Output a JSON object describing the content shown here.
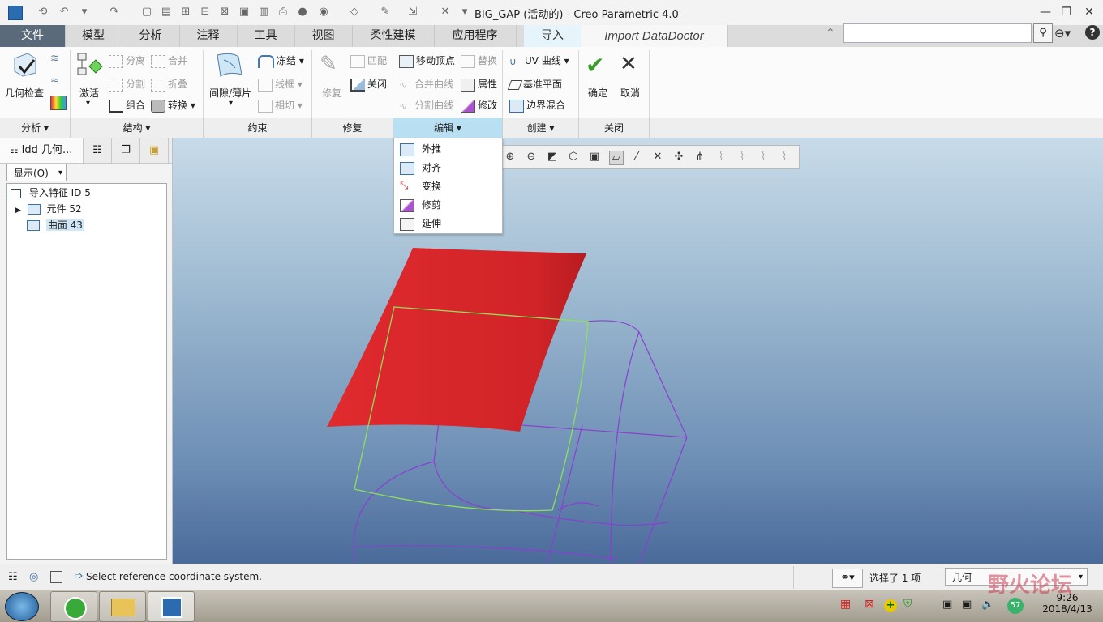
{
  "window": {
    "title": "BIG_GAP (活动的) - Creo Parametric 4.0",
    "minimize": "—",
    "maximize": "❐",
    "close": "✕"
  },
  "tabs": [
    {
      "label": "文件"
    },
    {
      "label": "模型"
    },
    {
      "label": "分析"
    },
    {
      "label": "注释"
    },
    {
      "label": "工具"
    },
    {
      "label": "视图"
    },
    {
      "label": "柔性建模"
    },
    {
      "label": "应用程序"
    },
    {
      "label": "导入"
    },
    {
      "label": "Import DataDoctor"
    }
  ],
  "search": {
    "value": ""
  },
  "ribbon": {
    "analysis": {
      "geo_check": "几何检查",
      "group": "分析"
    },
    "structure": {
      "activate": "激活",
      "separate": "分离",
      "merge": "合并",
      "split": "分割",
      "fold": "折叠",
      "combine": "组合",
      "convert": "转换",
      "group": "结构"
    },
    "constraint": {
      "gap": "间隙/薄片",
      "freeze": "冻结",
      "wireframe": "线框",
      "tangent": "相切",
      "group": "约束"
    },
    "repair": {
      "repair": "修复",
      "match": "匹配",
      "close": "关闭",
      "group": "修复"
    },
    "edit": {
      "move_vertex": "移动顶点",
      "replace": "替换",
      "merge_curve": "合并曲线",
      "property": "属性",
      "split_curve": "分割曲线",
      "modify": "修改",
      "group": "编辑"
    },
    "create": {
      "uv_curve": "UV 曲线",
      "datum_plane": "基准平面",
      "boundary_blend": "边界混合",
      "group": "创建"
    },
    "close": {
      "ok": "确定",
      "cancel": "取消",
      "group": "关闭"
    }
  },
  "edit_menu": [
    {
      "label": "外推"
    },
    {
      "label": "对齐"
    },
    {
      "label": "变换"
    },
    {
      "label": "修剪"
    },
    {
      "label": "延伸"
    }
  ],
  "left_panel": {
    "tab_label": "Idd 几何...",
    "show_button": "显示(O)",
    "tree": [
      {
        "label": "导入特征 ID 5"
      },
      {
        "label": "元件 52"
      },
      {
        "label": "曲面 43"
      }
    ]
  },
  "status": {
    "message": "Select reference coordinate system.",
    "selected": "选择了 1 项",
    "filter": "几何"
  },
  "taskbar": {
    "time": "9:26",
    "date": "2018/4/13",
    "badge": "57"
  },
  "watermark": "野火论坛",
  "colors": {
    "surface_red": "#d8272b",
    "wire_green": "#8ee05a",
    "wire_purple": "#8a3fd0"
  }
}
